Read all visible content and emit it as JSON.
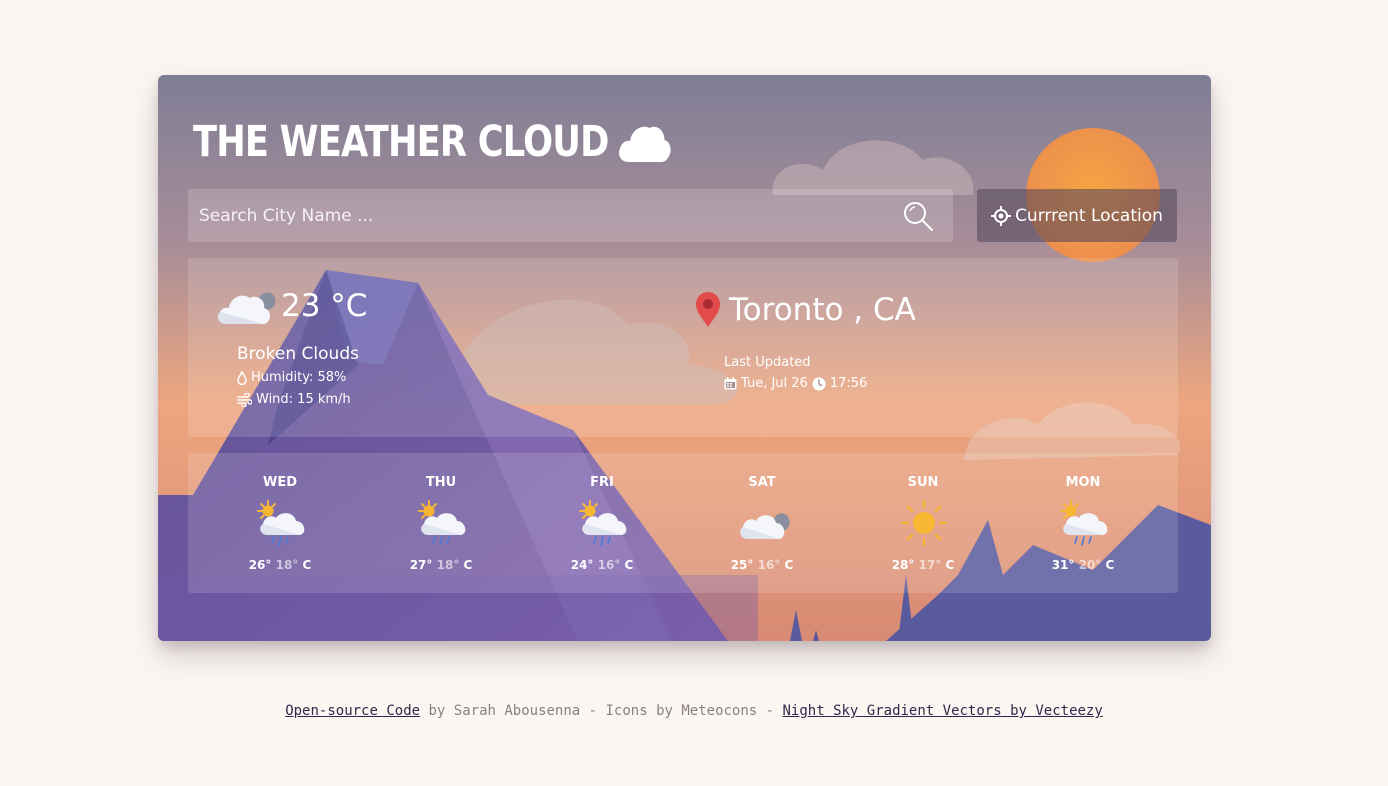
{
  "app": {
    "title": "THE WEATHER CLOUD",
    "title_icon": "cloud-icon"
  },
  "search": {
    "placeholder": "Search City Name ...",
    "value": "",
    "icon": "search-icon"
  },
  "location_button": {
    "label": "Currrent Location",
    "icon": "crosshair-icon"
  },
  "current": {
    "icon": "partly-cloudy-night-icon",
    "temperature": "23 °C",
    "description": "Broken Clouds",
    "humidity": "Humidity: 58%",
    "wind": "Wind: 15 km/h",
    "city": "Toronto , CA",
    "last_updated_label": "Last Updated",
    "date": "Tue, Jul 26",
    "time": "17:56"
  },
  "forecast": [
    {
      "day": "WED",
      "high": "26°",
      "low": "18°",
      "unit": "C",
      "icon": "sun-cloud-rain-icon"
    },
    {
      "day": "THU",
      "high": "27°",
      "low": "18°",
      "unit": "C",
      "icon": "sun-cloud-rain-icon"
    },
    {
      "day": "FRI",
      "high": "24°",
      "low": "16°",
      "unit": "C",
      "icon": "sun-cloud-rain-icon"
    },
    {
      "day": "SAT",
      "high": "25°",
      "low": "16°",
      "unit": "C",
      "icon": "cloudy-icon"
    },
    {
      "day": "SUN",
      "high": "28°",
      "low": "17°",
      "unit": "C",
      "icon": "sun-icon"
    },
    {
      "day": "MON",
      "high": "31°",
      "low": "20°",
      "unit": "C",
      "icon": "sun-cloud-rain-icon"
    }
  ],
  "footer": {
    "code_link": "Open-source Code",
    "by_text": " by Sarah Abousenna - Icons by Meteocons - ",
    "vectors_link": "Night Sky Gradient Vectors by Vecteezy"
  },
  "colors": {
    "page_bg": "#fcf6f2",
    "sky_top": "#7f7e96",
    "sky_bottom": "#f0a880",
    "mountain": "#5a5496",
    "sun": "#f5a343",
    "footer_link": "#2d2a4a"
  }
}
